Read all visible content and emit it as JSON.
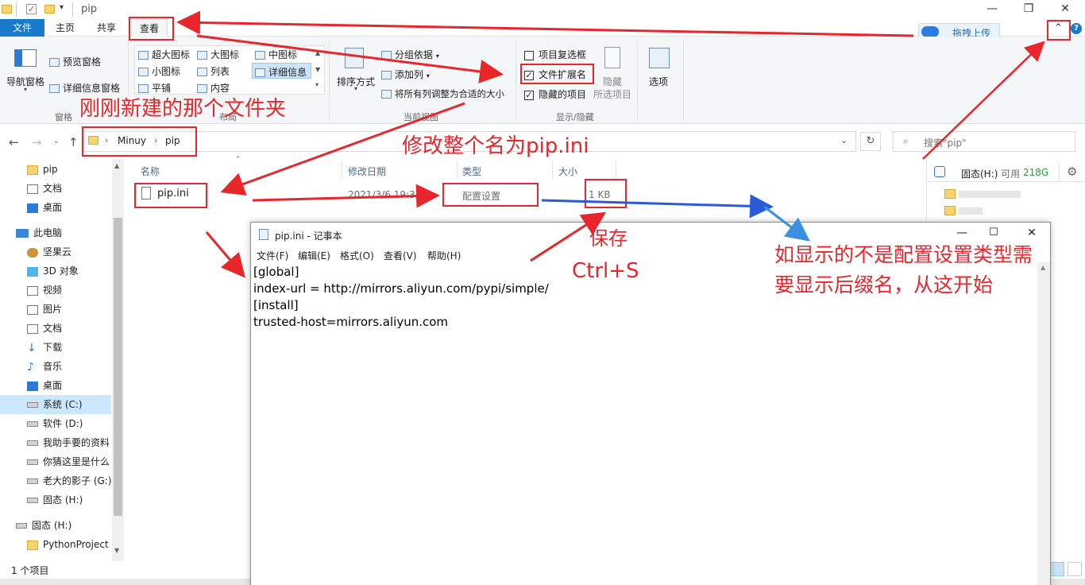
{
  "window": {
    "title": "pip"
  },
  "tabs": [
    "文件",
    "主页",
    "共享",
    "查看"
  ],
  "baidu": {
    "upload_label": "拖拽上传"
  },
  "ribbon": {
    "pane": {
      "nav_pane": "导航窗格",
      "preview_pane": "预览窗格",
      "details_pane": "详细信息窗格",
      "group": "窗格"
    },
    "layout": {
      "items": [
        "超大图标",
        "大图标",
        "中图标",
        "小图标",
        "列表",
        "详细信息",
        "平铺",
        "内容"
      ],
      "group": "布局"
    },
    "current_view": {
      "sort": "排序方式",
      "group_by": "分组依据",
      "add_column": "添加列",
      "fit_columns": "将所有列调整为合适的大小",
      "group": "当前视图"
    },
    "show_hide": {
      "item_checkbox": "项目复选框",
      "file_ext": "文件扩展名",
      "hidden_items": "隐藏的项目",
      "hide": "隐藏",
      "hide_selected": "所选项目",
      "group": "显示/隐藏"
    },
    "options": "选项"
  },
  "address": {
    "crumbs": [
      "Minuy",
      "pip"
    ],
    "search_placeholder": "搜索\"pip\""
  },
  "sidebar": {
    "quick": [
      {
        "label": "pip",
        "icon": "folder"
      },
      {
        "label": "文档",
        "icon": "doc"
      },
      {
        "label": "桌面",
        "icon": "desktop"
      }
    ],
    "this_pc": "此电脑",
    "pc_items": [
      {
        "label": "坚果云",
        "icon": "nut"
      },
      {
        "label": "3D 对象",
        "icon": "cube"
      },
      {
        "label": "视频",
        "icon": "video"
      },
      {
        "label": "图片",
        "icon": "picture"
      },
      {
        "label": "文档",
        "icon": "doc"
      },
      {
        "label": "下载",
        "icon": "download"
      },
      {
        "label": "音乐",
        "icon": "music"
      },
      {
        "label": "桌面",
        "icon": "desktop"
      },
      {
        "label": "系统 (C:)",
        "icon": "drive"
      },
      {
        "label": "软件 (D:)",
        "icon": "drive"
      },
      {
        "label": "我助手要的资料",
        "icon": "drive"
      },
      {
        "label": "你猜这里是什么",
        "icon": "drive"
      },
      {
        "label": "老大的影子 (G:)",
        "icon": "drive"
      },
      {
        "label": "固态 (H:)",
        "icon": "drive"
      }
    ],
    "drive_h": "固态 (H:)",
    "python_project": "PythonProject"
  },
  "columns": {
    "name": "名称",
    "date": "修改日期",
    "type": "类型",
    "size": "大小"
  },
  "file": {
    "name": "pip.ini",
    "date": "2021/3/6 19:37",
    "type": "配置设置",
    "size": "1 KB"
  },
  "right_pane": {
    "drive": "固态(H:)",
    "free_label": "可用",
    "free_value": "218G"
  },
  "status": {
    "count": "1 个项目"
  },
  "notepad": {
    "title": "pip.ini - 记事本",
    "menu": [
      "文件(F)",
      "编辑(E)",
      "格式(O)",
      "查看(V)",
      "帮助(H)"
    ],
    "lines": [
      "[global]",
      "index-url = http://mirrors.aliyun.com/pypi/simple/",
      "[install]",
      "trusted-host=mirrors.aliyun.com"
    ]
  },
  "annotations": {
    "folder": "刚刚新建的那个文件夹",
    "rename": "修改整个名为pip.ini",
    "save": "保存",
    "shortcut": "Ctrl+S",
    "hint_line1": "如显示的不是配置设置类型需",
    "hint_line2": "要显示后缀名，从这开始"
  },
  "colors": {
    "accent": "#1979ca",
    "annotation_red": "#e8262b",
    "annotation_blue": "#2a5bd7",
    "free_space": "#2a9d3a"
  }
}
